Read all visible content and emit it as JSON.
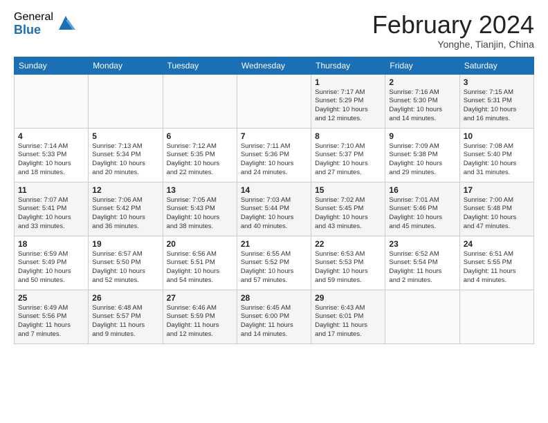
{
  "logo": {
    "general": "General",
    "blue": "Blue"
  },
  "title": "February 2024",
  "location": "Yonghe, Tianjin, China",
  "headers": [
    "Sunday",
    "Monday",
    "Tuesday",
    "Wednesday",
    "Thursday",
    "Friday",
    "Saturday"
  ],
  "weeks": [
    [
      {
        "day": "",
        "info": ""
      },
      {
        "day": "",
        "info": ""
      },
      {
        "day": "",
        "info": ""
      },
      {
        "day": "",
        "info": ""
      },
      {
        "day": "1",
        "info": "Sunrise: 7:17 AM\nSunset: 5:29 PM\nDaylight: 10 hours\nand 12 minutes."
      },
      {
        "day": "2",
        "info": "Sunrise: 7:16 AM\nSunset: 5:30 PM\nDaylight: 10 hours\nand 14 minutes."
      },
      {
        "day": "3",
        "info": "Sunrise: 7:15 AM\nSunset: 5:31 PM\nDaylight: 10 hours\nand 16 minutes."
      }
    ],
    [
      {
        "day": "4",
        "info": "Sunrise: 7:14 AM\nSunset: 5:33 PM\nDaylight: 10 hours\nand 18 minutes."
      },
      {
        "day": "5",
        "info": "Sunrise: 7:13 AM\nSunset: 5:34 PM\nDaylight: 10 hours\nand 20 minutes."
      },
      {
        "day": "6",
        "info": "Sunrise: 7:12 AM\nSunset: 5:35 PM\nDaylight: 10 hours\nand 22 minutes."
      },
      {
        "day": "7",
        "info": "Sunrise: 7:11 AM\nSunset: 5:36 PM\nDaylight: 10 hours\nand 24 minutes."
      },
      {
        "day": "8",
        "info": "Sunrise: 7:10 AM\nSunset: 5:37 PM\nDaylight: 10 hours\nand 27 minutes."
      },
      {
        "day": "9",
        "info": "Sunrise: 7:09 AM\nSunset: 5:38 PM\nDaylight: 10 hours\nand 29 minutes."
      },
      {
        "day": "10",
        "info": "Sunrise: 7:08 AM\nSunset: 5:40 PM\nDaylight: 10 hours\nand 31 minutes."
      }
    ],
    [
      {
        "day": "11",
        "info": "Sunrise: 7:07 AM\nSunset: 5:41 PM\nDaylight: 10 hours\nand 33 minutes."
      },
      {
        "day": "12",
        "info": "Sunrise: 7:06 AM\nSunset: 5:42 PM\nDaylight: 10 hours\nand 36 minutes."
      },
      {
        "day": "13",
        "info": "Sunrise: 7:05 AM\nSunset: 5:43 PM\nDaylight: 10 hours\nand 38 minutes."
      },
      {
        "day": "14",
        "info": "Sunrise: 7:03 AM\nSunset: 5:44 PM\nDaylight: 10 hours\nand 40 minutes."
      },
      {
        "day": "15",
        "info": "Sunrise: 7:02 AM\nSunset: 5:45 PM\nDaylight: 10 hours\nand 43 minutes."
      },
      {
        "day": "16",
        "info": "Sunrise: 7:01 AM\nSunset: 5:46 PM\nDaylight: 10 hours\nand 45 minutes."
      },
      {
        "day": "17",
        "info": "Sunrise: 7:00 AM\nSunset: 5:48 PM\nDaylight: 10 hours\nand 47 minutes."
      }
    ],
    [
      {
        "day": "18",
        "info": "Sunrise: 6:59 AM\nSunset: 5:49 PM\nDaylight: 10 hours\nand 50 minutes."
      },
      {
        "day": "19",
        "info": "Sunrise: 6:57 AM\nSunset: 5:50 PM\nDaylight: 10 hours\nand 52 minutes."
      },
      {
        "day": "20",
        "info": "Sunrise: 6:56 AM\nSunset: 5:51 PM\nDaylight: 10 hours\nand 54 minutes."
      },
      {
        "day": "21",
        "info": "Sunrise: 6:55 AM\nSunset: 5:52 PM\nDaylight: 10 hours\nand 57 minutes."
      },
      {
        "day": "22",
        "info": "Sunrise: 6:53 AM\nSunset: 5:53 PM\nDaylight: 10 hours\nand 59 minutes."
      },
      {
        "day": "23",
        "info": "Sunrise: 6:52 AM\nSunset: 5:54 PM\nDaylight: 11 hours\nand 2 minutes."
      },
      {
        "day": "24",
        "info": "Sunrise: 6:51 AM\nSunset: 5:55 PM\nDaylight: 11 hours\nand 4 minutes."
      }
    ],
    [
      {
        "day": "25",
        "info": "Sunrise: 6:49 AM\nSunset: 5:56 PM\nDaylight: 11 hours\nand 7 minutes."
      },
      {
        "day": "26",
        "info": "Sunrise: 6:48 AM\nSunset: 5:57 PM\nDaylight: 11 hours\nand 9 minutes."
      },
      {
        "day": "27",
        "info": "Sunrise: 6:46 AM\nSunset: 5:59 PM\nDaylight: 11 hours\nand 12 minutes."
      },
      {
        "day": "28",
        "info": "Sunrise: 6:45 AM\nSunset: 6:00 PM\nDaylight: 11 hours\nand 14 minutes."
      },
      {
        "day": "29",
        "info": "Sunrise: 6:43 AM\nSunset: 6:01 PM\nDaylight: 11 hours\nand 17 minutes."
      },
      {
        "day": "",
        "info": ""
      },
      {
        "day": "",
        "info": ""
      }
    ]
  ]
}
